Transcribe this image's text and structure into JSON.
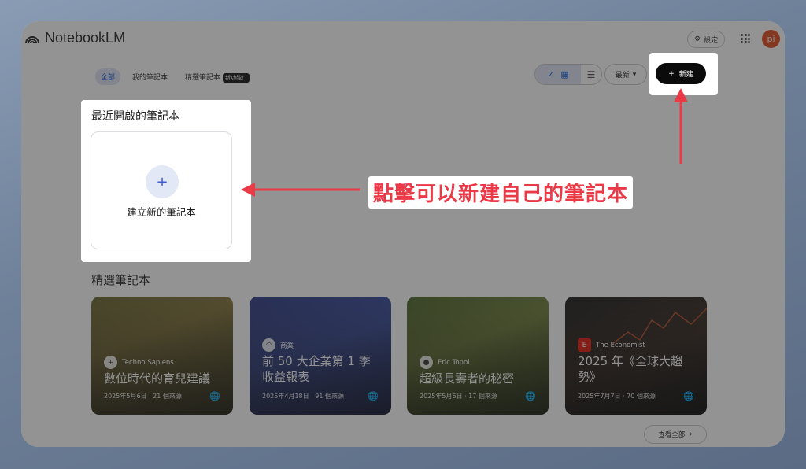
{
  "app": {
    "name": "NotebookLM"
  },
  "header": {
    "settings_label": "設定",
    "avatar_initials": "pi"
  },
  "tabs": [
    {
      "label": "全部",
      "active": true
    },
    {
      "label": "我的筆記本",
      "active": false
    },
    {
      "label": "精選筆記本",
      "active": false,
      "badge": "新功能！"
    }
  ],
  "toolbar": {
    "sort_label": "最新",
    "new_button_label": "新建"
  },
  "recent": {
    "title": "最近開啟的筆記本",
    "create_label": "建立新的筆記本"
  },
  "featured": {
    "title": "精選筆記本",
    "view_all_label": "查看全部",
    "cards": [
      {
        "source": "Techno Sapiens",
        "title": "數位時代的育兒建議",
        "meta": "2025年5月6日 · 21 個來源"
      },
      {
        "source": "商業",
        "title": "前 50 大企業第 1 季收益報表",
        "meta": "2025年4月18日 · 91 個來源"
      },
      {
        "source": "Eric Topol",
        "title": "超級長壽者的秘密",
        "meta": "2025年5月6日 · 17 個來源"
      },
      {
        "source": "The Economist",
        "title": "2025 年《全球大趨勢》",
        "meta": "2025年7月7日 · 70 個來源"
      }
    ]
  },
  "annotation": {
    "text": "點擊可以新建自己的筆記本",
    "color": "#ea3a48"
  }
}
